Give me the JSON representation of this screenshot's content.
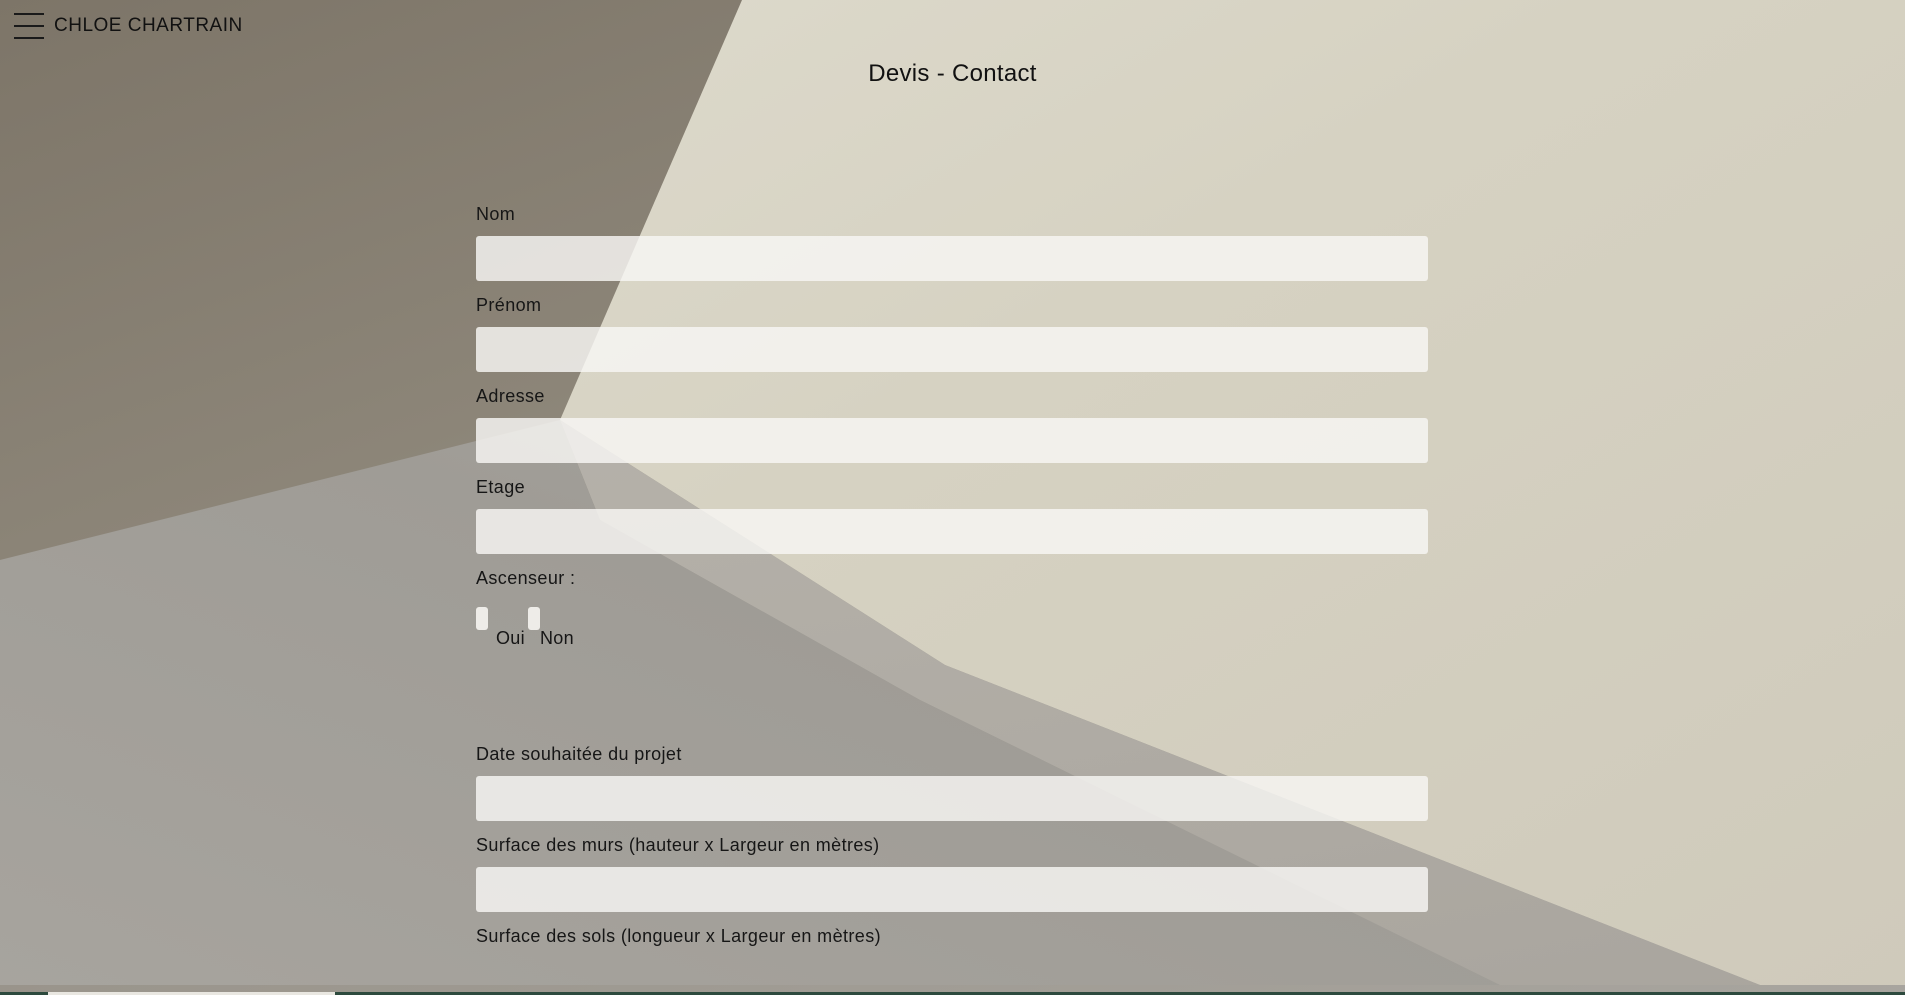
{
  "header": {
    "brand": "CHLOE CHARTRAIN",
    "menu_icon": "hamburger-menu-icon"
  },
  "page": {
    "title": "Devis - Contact"
  },
  "form": {
    "nom_label": "Nom",
    "nom_value": "",
    "prenom_label": "Prénom",
    "prenom_value": "",
    "adresse_label": "Adresse",
    "adresse_value": "",
    "etage_label": "Etage",
    "etage_value": "",
    "ascenseur_label": "Ascenseur :",
    "ascenseur_options": [
      "Oui",
      "Non"
    ],
    "date_label": "Date souhaitée du projet",
    "date_value": "",
    "murs_label": "Surface des murs (hauteur x Largeur en mètres)",
    "murs_value": "",
    "sols_label": "Surface des sols (longueur x Largeur en mètres)"
  },
  "colors": {
    "text": "#161616",
    "input_bg": "#f8f7f4",
    "bottom_bar": "#2d4a3e"
  }
}
